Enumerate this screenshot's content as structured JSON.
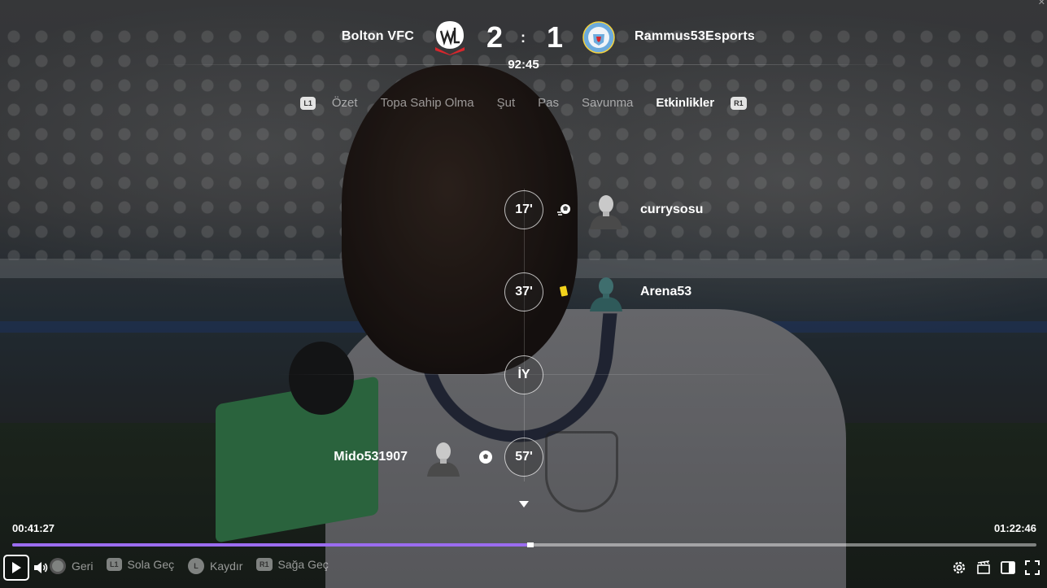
{
  "match": {
    "home_team": "Bolton VFC",
    "away_team": "Rammus53Esports",
    "home_score": "2",
    "away_score": "1",
    "separator": ":",
    "clock": "92:45"
  },
  "tabs": {
    "left_button": "L1",
    "right_button": "R1",
    "items": [
      {
        "label": "Özet"
      },
      {
        "label": "Topa Sahip Olma"
      },
      {
        "label": "Şut"
      },
      {
        "label": "Pas"
      },
      {
        "label": "Savunma"
      },
      {
        "label": "Etkinlikler",
        "active": true
      }
    ]
  },
  "events": [
    {
      "minute": "17'",
      "side": "away",
      "type": "assist-icon",
      "player": "currysosu"
    },
    {
      "minute": "37'",
      "side": "away",
      "type": "yellow-card-icon",
      "player": "Arena53"
    },
    {
      "minute": "İY",
      "side": "divider",
      "type": "",
      "player": ""
    },
    {
      "minute": "57'",
      "side": "home",
      "type": "goal-ball-icon",
      "player": "Mido531907"
    }
  ],
  "video": {
    "elapsed": "00:41:27",
    "duration": "01:22:46",
    "progress": 0.503,
    "accent": "#9b6cf0"
  },
  "hints": {
    "back": {
      "button": "circle",
      "label": "Geri"
    },
    "prev": {
      "button": "L1",
      "label": "Sola Geç"
    },
    "scroll": {
      "button": "L",
      "label": "Kaydır"
    },
    "next": {
      "button": "R1",
      "label": "Sağa Geç"
    }
  },
  "colors": {
    "yellow_card": "#f2d21b",
    "bolton_red": "#d8262c",
    "city_blue": "#6cabdd"
  }
}
